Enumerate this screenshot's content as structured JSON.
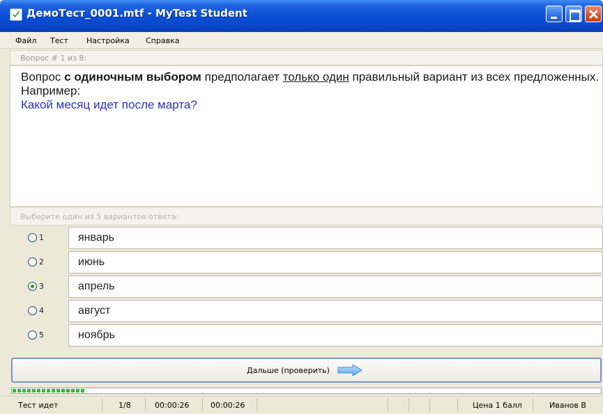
{
  "window": {
    "title": "ДемоТест_0001.mtf - MyTest Student"
  },
  "menu": [
    "Файл",
    "Тест",
    "Настройка",
    "Справка"
  ],
  "question": {
    "header": "Вопрос # 1 из 8:",
    "text_part1": "Вопрос ",
    "text_bold": "с одиночным выбором",
    "text_part2": " предполагает ",
    "text_underline": "только один",
    "text_part3": " правильный вариант из всех предложенных. Например:",
    "example": "Какой месяц идет после марта?"
  },
  "answers": {
    "header": "Выберите один из 5 вариантов ответа:",
    "options": [
      {
        "num": "1",
        "label": "январь",
        "selected": false
      },
      {
        "num": "2",
        "label": "июнь",
        "selected": false
      },
      {
        "num": "3",
        "label": "апрель",
        "selected": true
      },
      {
        "num": "4",
        "label": "август",
        "selected": false
      },
      {
        "num": "5",
        "label": "ноябрь",
        "selected": false
      }
    ]
  },
  "next_button": {
    "label": "Дальше (проверить)",
    "icon": "arrow-right-icon"
  },
  "progress": {
    "fraction": 0.125
  },
  "status": {
    "state": "Тест идет",
    "counter": "1/8",
    "time1": "00:00:26",
    "time2": "00:00:26",
    "price": "Цена 1 балл",
    "user": "Иванов В"
  },
  "colors": {
    "title_bar": "#0a4fd5",
    "example_text": "#2d2dc5",
    "progress_fill": "#29c229"
  }
}
